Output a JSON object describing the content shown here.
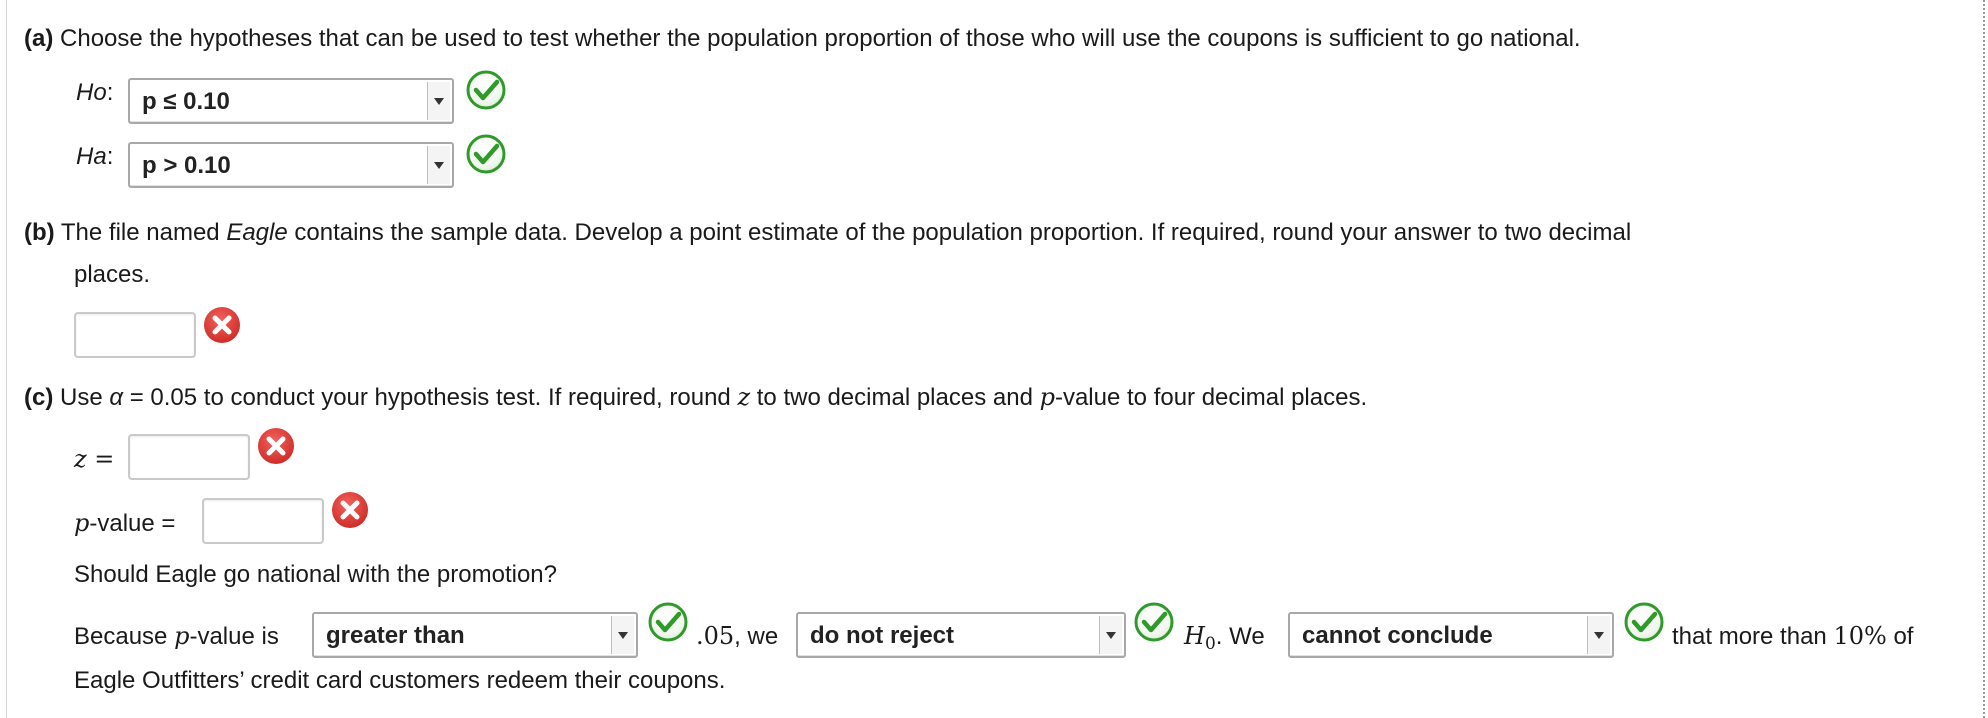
{
  "part_a": {
    "label": "(a)",
    "text": "Choose the hypotheses that can be used to test whether the population proportion of those who will use the coupons is sufficient to go national.",
    "h0_label": "H",
    "h0_sub": "o",
    "ha_label": "H",
    "ha_sub": "a",
    "h0_value": "p ≤ 0.10",
    "ha_value": "p > 0.10"
  },
  "part_b": {
    "label": "(b)",
    "text_before": "The file named ",
    "file_name": "Eagle",
    "text_after": " contains the sample data. Develop a point estimate of the population proportion. If required, round your answer to two decimal",
    "text_line2": "places.",
    "answer_value": ""
  },
  "part_c": {
    "label": "(c)",
    "text_use": "Use ",
    "alpha_symbol": "α",
    "alpha_eq": " = 0.05 to conduct your hypothesis test. If required, round ",
    "z_symbol": "z",
    "mid_text": " to two decimal places and ",
    "p_symbol": "p",
    "end_text": "-value to four decimal places.",
    "z_label": "z =",
    "z_value": "",
    "pvalue_p": "p",
    "pvalue_label": "-value =",
    "pvalue_value": "",
    "question": "Should Eagle go national with the promotion?",
    "because_text": "Because ",
    "because_p": "p",
    "because_rest": "-value is",
    "compare_value": "greater than",
    "alpha_num": ".05",
    "we_text": ", we",
    "decision_value": "do not reject",
    "h0_symbol": "H",
    "h0_sub": "0",
    "we_text2": ". We",
    "conclusion_value": "cannot conclude",
    "that_text": "that more than ",
    "percent_text": "10%",
    "of_text": " of",
    "line2": "Eagle Outfitters’ credit card customers redeem their coupons."
  },
  "colors": {
    "correct": "#2f9a2a",
    "incorrect": "#d9302c"
  },
  "icons": {
    "correct": "checkmark-circle-icon",
    "incorrect": "x-circle-icon"
  }
}
